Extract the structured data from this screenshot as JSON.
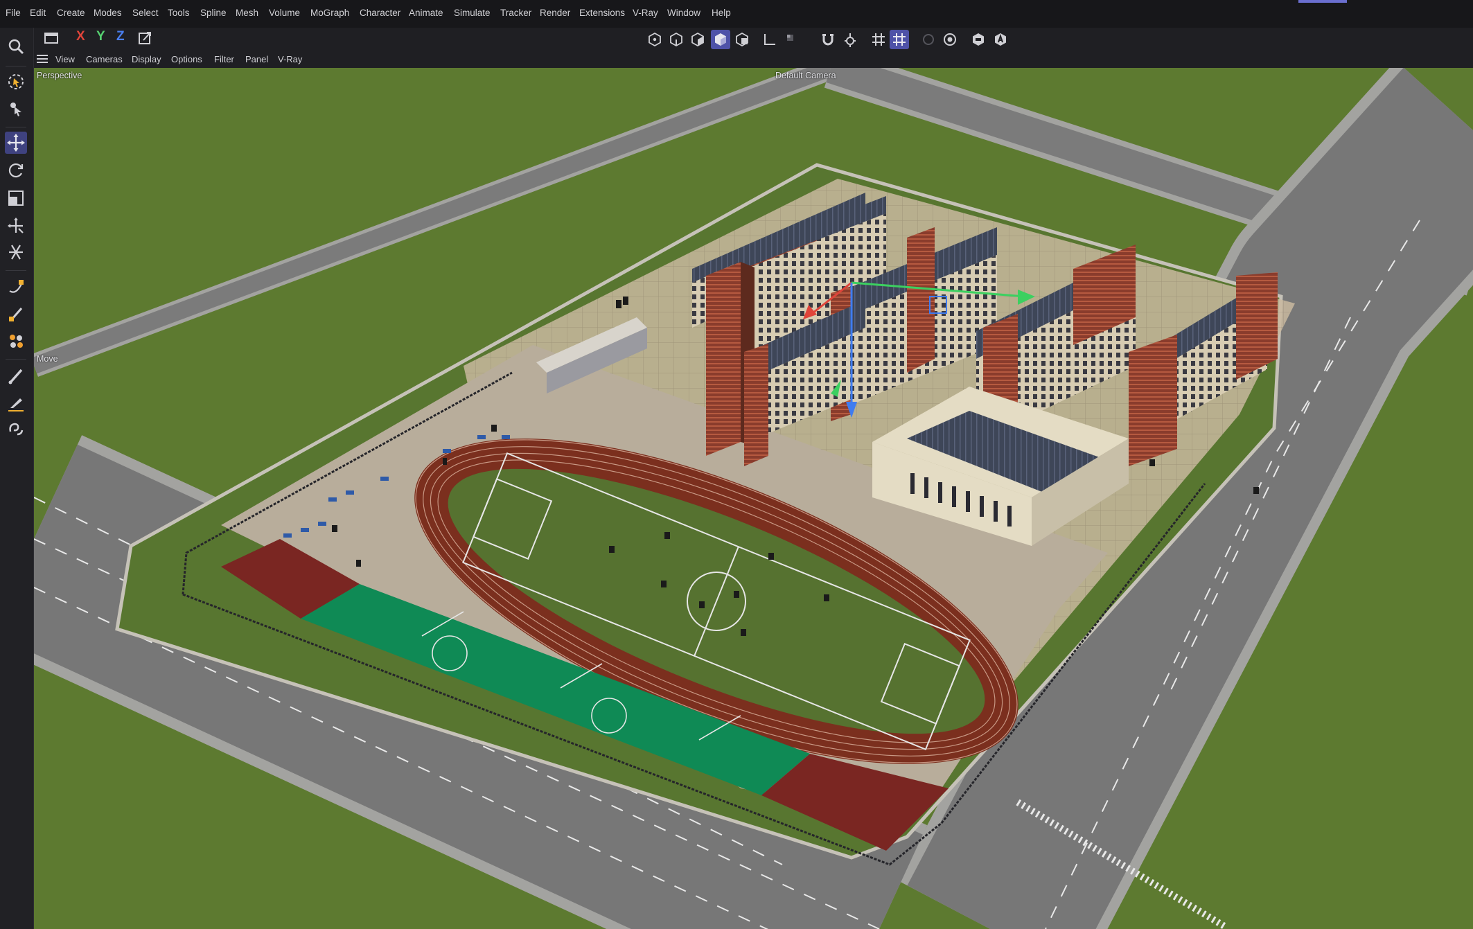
{
  "menubar": {
    "items": [
      "File",
      "Edit",
      "Create",
      "Modes",
      "Select",
      "Tools",
      "Spline",
      "Mesh",
      "Volume",
      "MoGraph",
      "Character",
      "Animate",
      "Simulate",
      "Tracker",
      "Render",
      "Extensions",
      "V-Ray",
      "Window",
      "Help"
    ]
  },
  "toolbar": {
    "axis_x": "X",
    "axis_y": "Y",
    "axis_z": "Z",
    "icons": [
      "undo-icon",
      "axis-x-lock",
      "axis-y-lock",
      "axis-z-lock",
      "coord-system-icon",
      "points-mode-icon",
      "edges-mode-icon",
      "polygons-mode-icon",
      "object-mode-icon",
      "uvw-mode-icon",
      "axis-mode-icon",
      "texture-mode-icon",
      "snap-icon",
      "snap-settings-icon",
      "grid-icon",
      "workplane-icon",
      "render-region-icon",
      "render-view-icon",
      "render-picture-viewer-icon",
      "render-settings-icon"
    ],
    "active": [
      "object-mode-icon",
      "workplane-icon"
    ]
  },
  "viewport_menu": {
    "items": [
      "View",
      "Cameras",
      "Display",
      "Options",
      "Filter",
      "Panel",
      "V-Ray"
    ]
  },
  "viewport": {
    "label": "Perspective",
    "camera": "Default Camera",
    "tool_hint": "Move"
  },
  "left_tools": {
    "items": [
      "zoom-icon",
      "live-selection-icon",
      "selection-tools-icon",
      "move-icon",
      "rotate-icon",
      "scale-icon",
      "transform-icon",
      "soft-transform-icon",
      "spline-pen-icon",
      "sketch-icon",
      "mograph-icon",
      "brush-icon",
      "knife-icon",
      "magnet-icon"
    ],
    "active": "move-icon"
  },
  "colors": {
    "accent": "#5155b0",
    "axis_x": "#e0443a",
    "axis_y": "#3cd060",
    "axis_z": "#3f7cf0",
    "grass": "#5d7a30",
    "track": "#7b2f1e",
    "court_green": "#0f8a55",
    "court_red": "#7a2622",
    "roof": "#3e4658",
    "brick": "#8a3c2c"
  }
}
